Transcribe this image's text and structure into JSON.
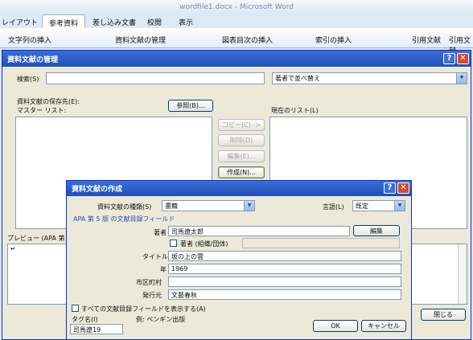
{
  "app": {
    "window_title": "wordfile1.docx - Microsoft Word",
    "tabs": [
      "レイアウト",
      "参考資料",
      "差し込み文書",
      "校閲",
      "表示"
    ],
    "active_tab": "参考資料",
    "ribbon": {
      "toc_button": "文字列の挿入",
      "manage_sources": "資料文献の管理",
      "insert_table_of_figures": "図表目次の挿入",
      "insert_index": "索引の挿入",
      "cite_table": "引用文献",
      "insert_toa": "引用文献一"
    }
  },
  "manage_dialog": {
    "title": "資料文献の管理",
    "search_label": "検索(S)",
    "search_value": "",
    "sort_value": "著者で並べ替え",
    "storage_label": "資料文献の保存先(E):",
    "master_list_label": "マスター リスト:",
    "browse_button": "参照(B)...",
    "current_list_label": "現在のリスト(L)",
    "copy_button": "コピー(C) ->",
    "delete_button": "削除(D)",
    "edit_button": "編集(E)...",
    "new_button": "作成(N)...",
    "preview_label": "プレビュー (APA 第",
    "close_button": "閉じる"
  },
  "create_dialog": {
    "title": "資料文献の作成",
    "source_type_label": "資料文献の種類(S)",
    "source_type_value": "書籍",
    "language_label": "言語(L)",
    "language_value": "既定",
    "fields_heading": "APA 第 5 版 の文献目録フィールド",
    "author_label": "著者",
    "author_value": "司馬遼太郎",
    "edit_button": "編集",
    "corporate_label": "著者 (組織/団体)",
    "title_label": "タイトル",
    "title_value": "坂の上の雲",
    "year_label": "年",
    "year_value": "1969",
    "city_label": "市区町村",
    "city_value": "",
    "publisher_label": "発行元",
    "publisher_value": "文藝春秋",
    "show_all_label": "すべての文献目録フィールドを表示する(A)",
    "tag_label": "タグ名(I)",
    "tag_value": "司馬遼19",
    "example_label": "例: ペンギン出版",
    "ok_button": "OK",
    "cancel_button": "キャンセル"
  }
}
